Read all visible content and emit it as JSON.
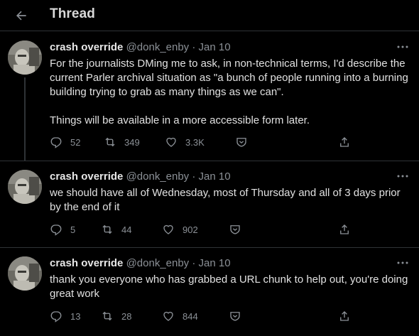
{
  "header": {
    "title": "Thread",
    "back_icon": "arrow-left-icon"
  },
  "colors": {
    "background": "#000000",
    "text": "#e1e1e1",
    "secondary": "#8b9096",
    "divider": "#2f3336"
  },
  "tweets": [
    {
      "name": "crash override",
      "handle": "@donk_enby",
      "dot": "·",
      "date": "Jan 10",
      "text": "For the journalists DMing me to ask, in non-technical terms, I'd describe the current Parler archival situation as \"a bunch of people running into a burning building trying to grab as many things as we can\".\n\nThings will be available in a more accessible form later.",
      "replies": "52",
      "retweets": "349",
      "likes": "3.3K"
    },
    {
      "name": "crash override",
      "handle": "@donk_enby",
      "dot": "·",
      "date": "Jan 10",
      "text": "we should have all of Wednesday, most of Thursday and all of 3 days prior by the end of it",
      "replies": "5",
      "retweets": "44",
      "likes": "902"
    },
    {
      "name": "crash override",
      "handle": "@donk_enby",
      "dot": "·",
      "date": "Jan 10",
      "text": "thank you everyone who has grabbed a URL chunk to help out, you're doing great work",
      "replies": "13",
      "retweets": "28",
      "likes": "844"
    }
  ]
}
